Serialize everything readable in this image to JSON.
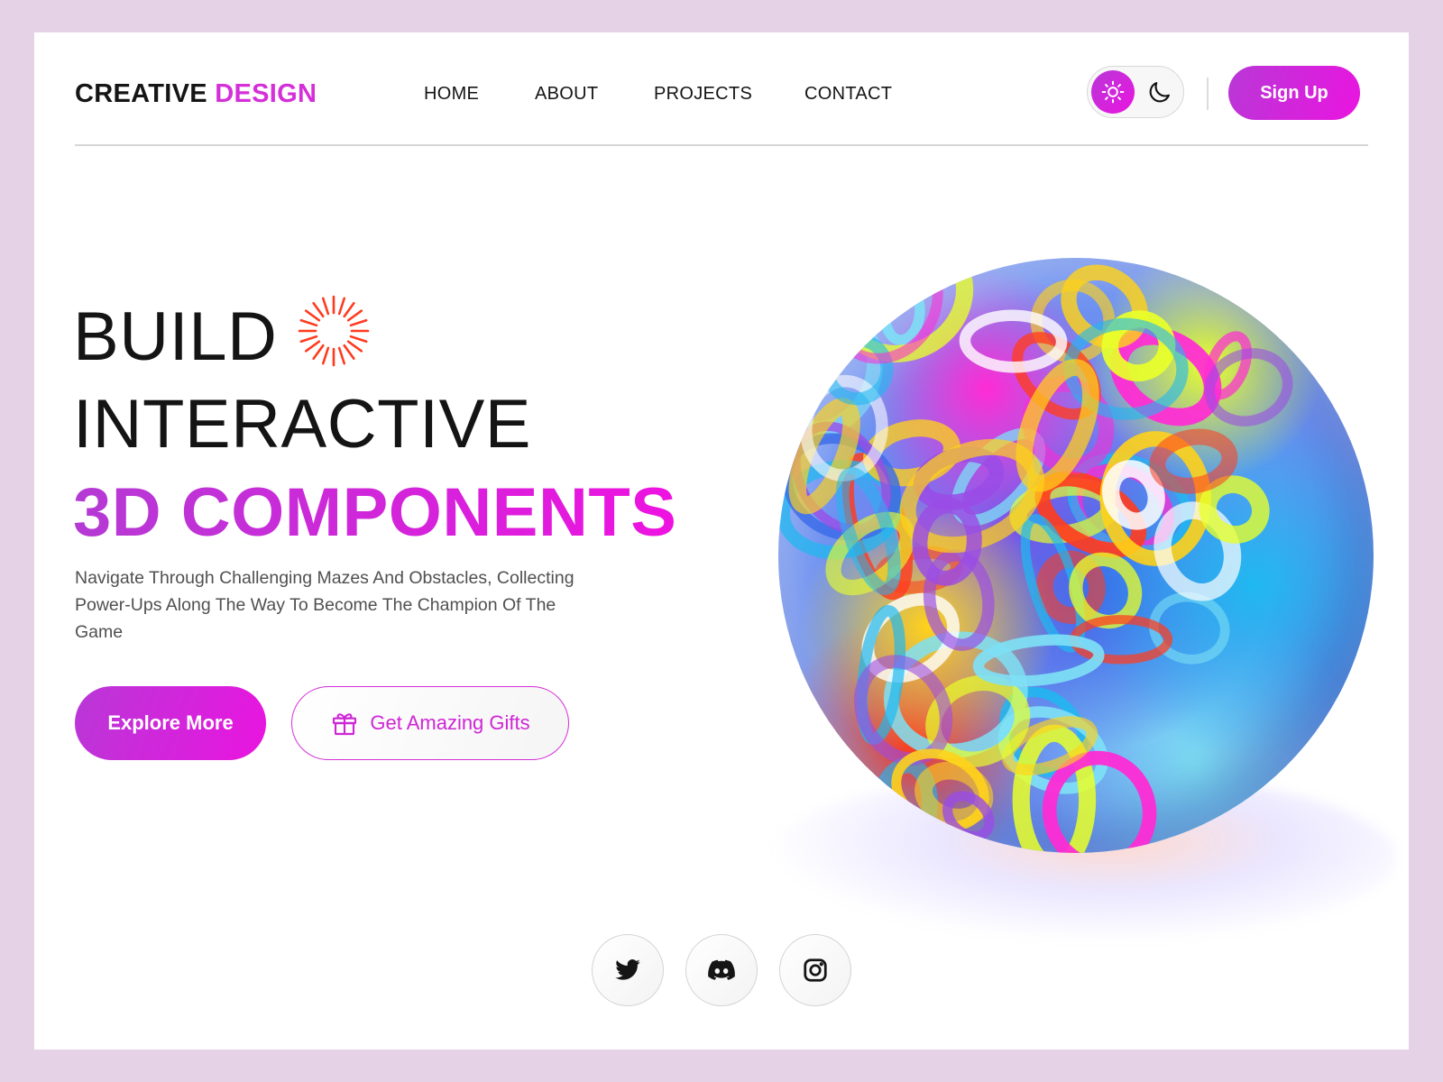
{
  "brand": {
    "name_part1": "CREATIVE",
    "name_part2": "DESIGN"
  },
  "nav": {
    "items": [
      {
        "label": "HOME"
      },
      {
        "label": "ABOUT"
      },
      {
        "label": "PROJECTS"
      },
      {
        "label": "CONTACT"
      }
    ]
  },
  "theme_toggle": {
    "options": [
      "sun-icon",
      "moon-icon"
    ],
    "selected": "light"
  },
  "header": {
    "signup_label": "Sign Up"
  },
  "hero": {
    "line1": "BUILD",
    "line2": "INTERACTIVE",
    "line3": "3D COMPONENTS",
    "description": "Navigate Through Challenging Mazes And Obstacles, Collecting Power-Ups Along The Way To Become The Champion Of The Game",
    "primary_button": "Explore More",
    "secondary_button": "Get Amazing Gifts",
    "secondary_icon": "gift-icon",
    "decor_icon": "sunburst-icon",
    "image": "3d-rainbow-knot-sphere"
  },
  "social": [
    {
      "name": "Twitter",
      "icon": "twitter-icon"
    },
    {
      "name": "Discord",
      "icon": "discord-icon"
    },
    {
      "name": "Instagram",
      "icon": "instagram-icon"
    }
  ],
  "colors": {
    "accent_start": "#b838d6",
    "accent_end": "#ea14e0",
    "text": "#151515",
    "muted": "#505050",
    "page_bg": "#e6d2e6",
    "burst": "#ff3b1f"
  }
}
